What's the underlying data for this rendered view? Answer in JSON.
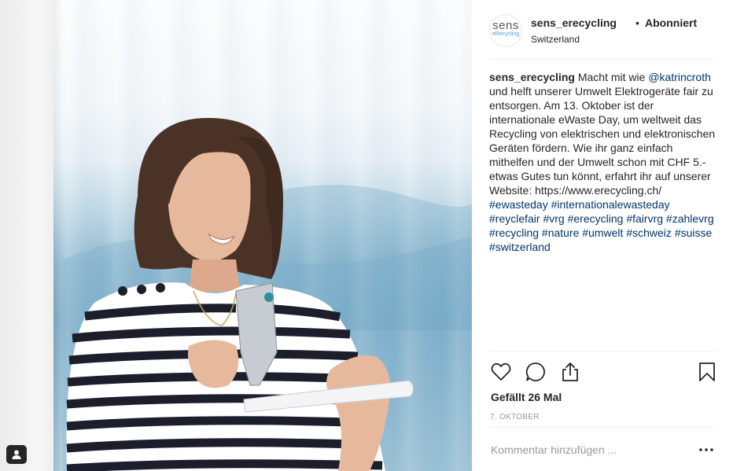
{
  "post": {
    "account": {
      "avatar_brand": "sens",
      "avatar_sub": "eRecycling",
      "username": "sens_erecycling",
      "separator": "•",
      "follow_status": "Abonniert",
      "location": "Switzerland"
    },
    "caption": {
      "username": "sens_erecycling",
      "text_1": " Macht mit wie ",
      "mention": "@katrincroth",
      "text_2": " und helft unserer Umwelt Elektrogeräte fair zu entsorgen. Am 13. Oktober ist der internationale eWaste Day, um weltweit das Recycling von elektrischen und elektronischen Geräten fördern. Wie ihr ganz einfach mithelfen und der Umwelt schon mit CHF 5.- etwas Gutes tun könnt, erfahrt ihr auf unserer Website: https://www.erecycling.ch/ ",
      "hashtags": [
        "#ewasteday",
        "#internationalewasteday",
        "#reyclefair",
        "#vrg",
        "#erecycling",
        "#fairvrg",
        "#zahlevrg",
        "#recycling",
        "#nature",
        "#umwelt",
        "#schweiz",
        "#suisse",
        "#switzerland"
      ]
    },
    "actions": {
      "like_icon": "heart-icon",
      "comment_icon": "comment-bubble-icon",
      "share_icon": "share-icon",
      "save_icon": "bookmark-icon"
    },
    "likes_text": "Gefällt 26 Mal",
    "date_text": "7. OKTOBER",
    "comment": {
      "placeholder": "Kommentar hinzufügen ...",
      "value": "",
      "more_icon": "more-options-icon"
    }
  },
  "colors": {
    "link": "#003569",
    "text": "#262626",
    "muted": "#999999",
    "divider": "#efefef"
  }
}
